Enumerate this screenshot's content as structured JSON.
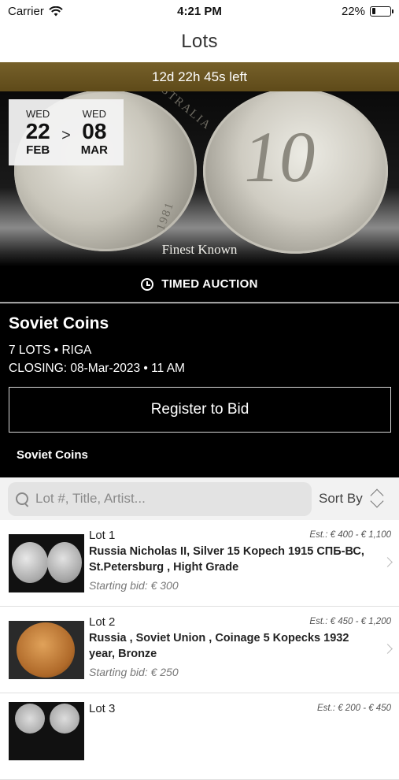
{
  "status": {
    "carrier": "Carrier",
    "time": "4:21 PM",
    "battery": "22%",
    "battery_level": 0.22
  },
  "nav": {
    "title": "Lots"
  },
  "countdown": "12d 22h 45s left",
  "hero": {
    "caption": "Finest Known",
    "coin_denomination": "10",
    "coin_legend": "AUSTRALIA",
    "coin_year": "1981"
  },
  "dates": {
    "start": {
      "dow": "WED",
      "day": "22",
      "month": "FEB"
    },
    "separator": ">",
    "end": {
      "dow": "WED",
      "day": "08",
      "month": "MAR"
    }
  },
  "auction": {
    "type_label": "TIMED AUCTION",
    "title": "Soviet Coins",
    "meta": "7 LOTS • RIGA",
    "closing": "CLOSING: 08-Mar-2023 • 11 AM",
    "register_label": "Register to Bid",
    "category": "Soviet Coins"
  },
  "search": {
    "placeholder": "Lot #, Title, Artist...",
    "sort_label": "Sort By"
  },
  "lots": [
    {
      "number": "Lot 1",
      "estimate": "Est.: € 400 - € 1,100",
      "title": "Russia Nicholas II, Silver 15 Kopech 1915 СПБ-ВС, St.Petersburg , Hight Grade",
      "starting_bid": "Starting bid: € 300"
    },
    {
      "number": "Lot 2",
      "estimate": "Est.: € 450 - € 1,200",
      "title": "Russia , Soviet Union , Coinage 5 Kopecks 1932 year, Bronze",
      "starting_bid": "Starting bid: € 250"
    },
    {
      "number": "Lot 3",
      "estimate": "Est.: € 200 - € 450",
      "title": "",
      "starting_bid": ""
    }
  ]
}
